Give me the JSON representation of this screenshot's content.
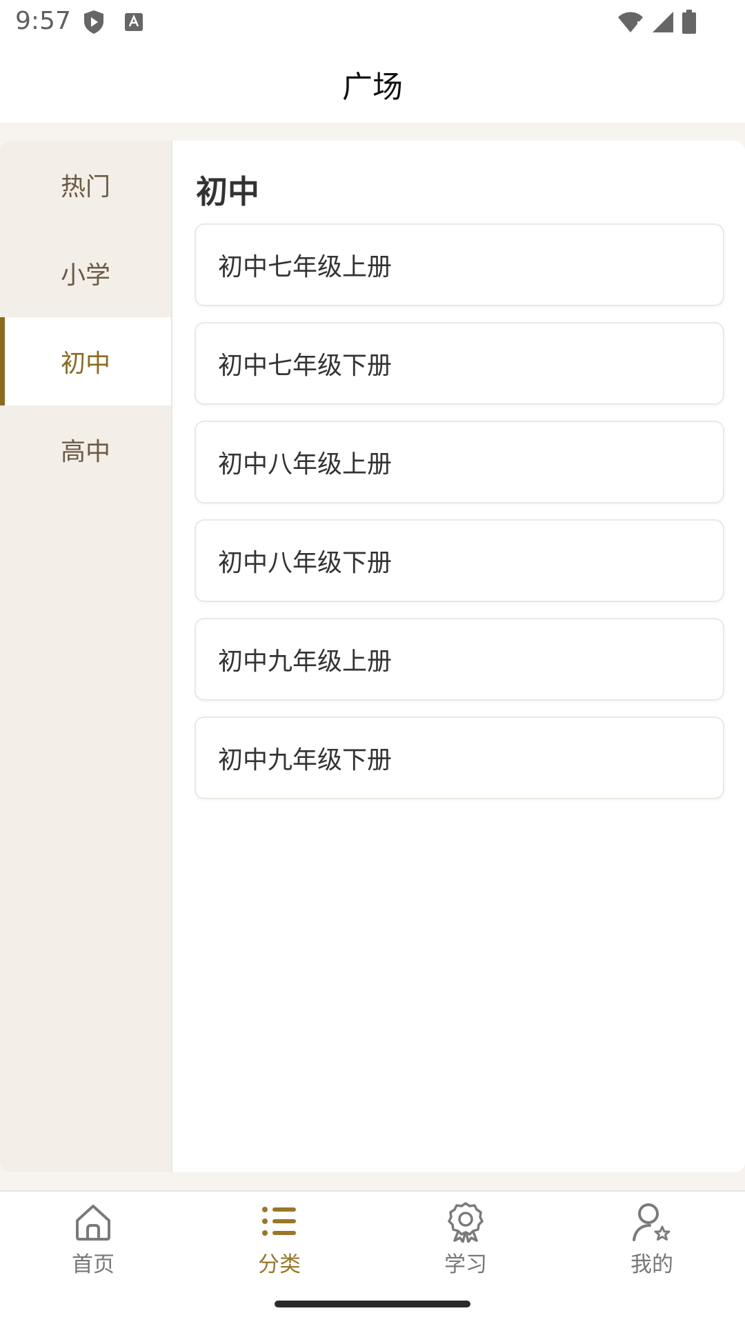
{
  "status_bar": {
    "time": "9:57",
    "left_icons": [
      "shield-play-icon",
      "text-a-icon"
    ],
    "right_icons": [
      "wifi-icon",
      "signal-icon",
      "battery-icon"
    ]
  },
  "header": {
    "title": "广场"
  },
  "sidebar": {
    "items": [
      {
        "label": "热门",
        "active": false
      },
      {
        "label": "小学",
        "active": false
      },
      {
        "label": "初中",
        "active": true
      },
      {
        "label": "高中",
        "active": false
      }
    ]
  },
  "main": {
    "section_title": "初中",
    "items": [
      {
        "label": "初中七年级上册"
      },
      {
        "label": "初中七年级下册"
      },
      {
        "label": "初中八年级上册"
      },
      {
        "label": "初中八年级下册"
      },
      {
        "label": "初中九年级上册"
      },
      {
        "label": "初中九年级下册"
      }
    ]
  },
  "tabbar": {
    "tabs": [
      {
        "label": "首页",
        "icon": "home-icon",
        "active": false
      },
      {
        "label": "分类",
        "icon": "list-icon",
        "active": true
      },
      {
        "label": "学习",
        "icon": "badge-icon",
        "active": false
      },
      {
        "label": "我的",
        "icon": "user-star-icon",
        "active": false
      }
    ]
  },
  "colors": {
    "accent": "#8c6a1f",
    "sidebar_bg": "#f3eee7",
    "content_bg": "#f7f4ef"
  }
}
